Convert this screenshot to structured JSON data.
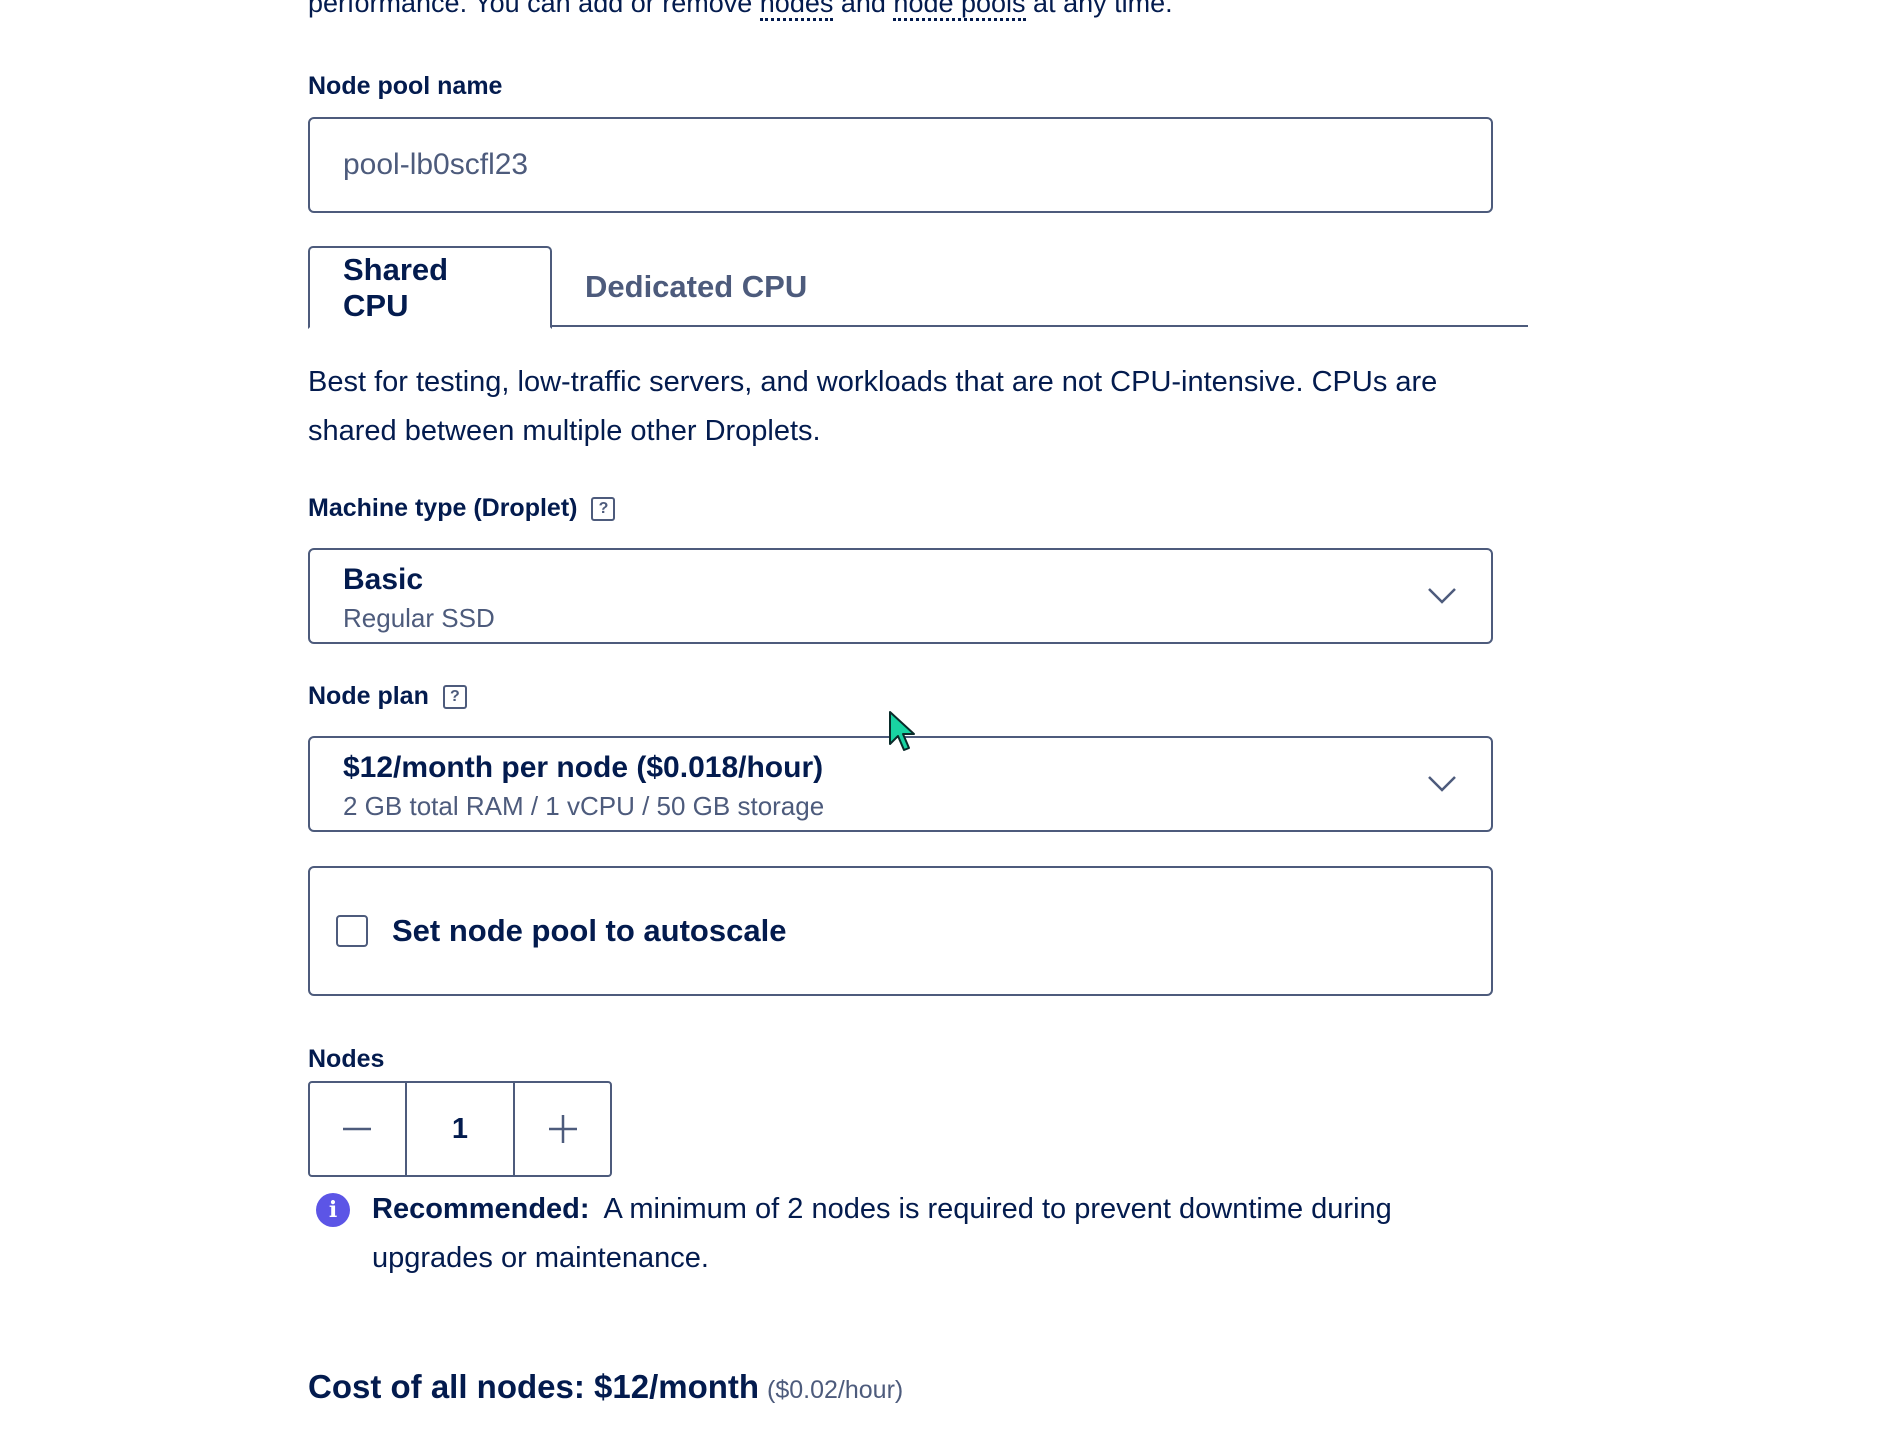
{
  "intro": {
    "prefix": "performance. You can add or remove ",
    "nodes_link": "nodes",
    "middle": " and ",
    "node_pools_link": "node pools",
    "suffix": " at any time."
  },
  "node_pool_name": {
    "label": "Node pool name",
    "value": "pool-lb0scfl23"
  },
  "tabs": [
    {
      "label": "Shared CPU",
      "active": true
    },
    {
      "label": "Dedicated CPU",
      "active": false
    }
  ],
  "tab_description": "Best for testing, low-traffic servers, and workloads that are not CPU-intensive. CPUs are shared between multiple other Droplets.",
  "machine_type": {
    "label": "Machine type (Droplet)",
    "help": "?",
    "selected_main": "Basic",
    "selected_sub": "Regular SSD"
  },
  "node_plan": {
    "label": "Node plan",
    "help": "?",
    "selected_main": "$12/month per node ($0.018/hour)",
    "selected_sub": "2 GB total RAM / 1 vCPU / 50 GB storage"
  },
  "autoscale": {
    "label": "Set node pool to autoscale",
    "checked": false
  },
  "nodes": {
    "label": "Nodes",
    "value": "1"
  },
  "recommendation": {
    "icon": "info-icon",
    "title": "Recommended:",
    "text": "A minimum of 2 nodes is required to prevent downtime during upgrades or maintenance."
  },
  "cost": {
    "main": "Cost of all nodes: $12/month",
    "hourly": "($0.02/hour)"
  },
  "colors": {
    "text": "#031b4e",
    "muted": "#4d5b7c",
    "info": "#5c55e6",
    "cursor": "#19d3a2"
  }
}
